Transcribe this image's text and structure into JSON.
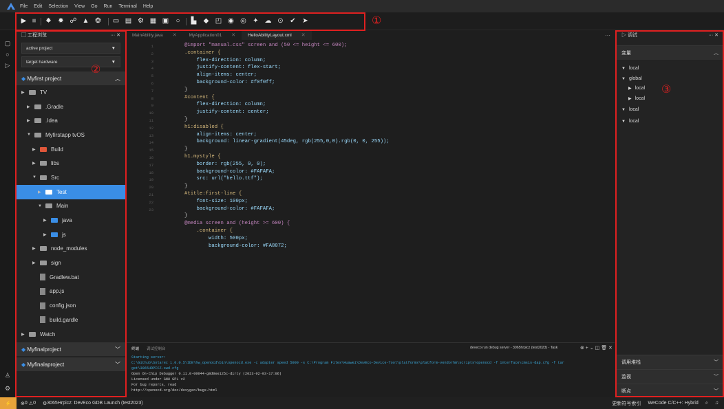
{
  "menu": [
    "File",
    "Edit",
    "Selection",
    "View",
    "Go",
    "Run",
    "Terminal",
    "Help"
  ],
  "toolbar": {
    "icons": [
      "run-icon",
      "stop-icon",
      "build-icon",
      "clean-icon",
      "debug-icon",
      "warning-icon",
      "settings-icon",
      "device-icon",
      "save-icon",
      "gear-icon",
      "grid-icon",
      "chip-icon",
      "search-icon",
      "file-icon",
      "preview-icon",
      "layout-icon",
      "deploy-icon",
      "record-icon",
      "plugin-icon",
      "cloud-icon",
      "target-icon",
      "check-icon",
      "send-icon"
    ]
  },
  "callouts": {
    "one": "①",
    "two": "②",
    "three": "③"
  },
  "explorer": {
    "title": "工程浏览",
    "dropdown1": "active project",
    "dropdown2": "target hardware",
    "project1": "Myfirst project",
    "tree": [
      {
        "label": "TV",
        "type": "folder",
        "arrow": "▶"
      },
      {
        "label": ".Gradle",
        "type": "folder",
        "arrow": "▶"
      },
      {
        "label": ".Idea",
        "type": "folder",
        "arrow": "▶"
      },
      {
        "label": "Myfirstapp tvOS",
        "type": "folder",
        "arrow": "▼"
      },
      {
        "label": "Build",
        "type": "folder",
        "arrow": "▶"
      },
      {
        "label": "libs",
        "type": "folder",
        "arrow": "▶"
      },
      {
        "label": "Src",
        "type": "folder",
        "arrow": "▼"
      },
      {
        "label": "Test",
        "type": "folder",
        "arrow": "▶"
      },
      {
        "label": "Main",
        "type": "folder",
        "arrow": "▼"
      },
      {
        "label": "java",
        "type": "folder",
        "arrow": "▶"
      },
      {
        "label": "js",
        "type": "folder",
        "arrow": "▶"
      },
      {
        "label": "node_modules",
        "type": "folder",
        "arrow": "▶"
      },
      {
        "label": "sign",
        "type": "folder",
        "arrow": "▶"
      },
      {
        "label": "Gradlew.bat",
        "type": "file",
        "arrow": ""
      },
      {
        "label": "app.js",
        "type": "file",
        "arrow": ""
      },
      {
        "label": "config.json",
        "type": "file",
        "arrow": ""
      },
      {
        "label": "build.gardle",
        "type": "file",
        "arrow": ""
      },
      {
        "label": "Watch",
        "type": "folder",
        "arrow": "▶"
      }
    ],
    "project2": "Myfinalproject",
    "project3": "Myfinalaproject"
  },
  "tabs": [
    {
      "label": "MainAbility.java",
      "active": false
    },
    {
      "label": "MyApplication01",
      "active": false
    },
    {
      "label": "HelloAbilityLayout.xml",
      "active": true
    }
  ],
  "editor": {
    "lines": [
      {
        "n": "1",
        "t": "@import \"manual.css\" screen and (50 <= height <= 600);",
        "c": "c-at"
      },
      {
        "n": "2",
        "t": ".container {",
        "c": "c-sel"
      },
      {
        "n": "3",
        "t": "    flex-direction: column;",
        "c": "c-prop"
      },
      {
        "n": "4",
        "t": "    justify-content: flex-start;",
        "c": "c-prop"
      },
      {
        "n": "5",
        "t": "    align-items: center;",
        "c": "c-prop"
      },
      {
        "n": "6",
        "t": "    background-color: #f0f0ff;",
        "c": "c-prop"
      },
      {
        "n": "7",
        "t": "}",
        "c": ""
      },
      {
        "n": "8",
        "t": "#content {",
        "c": "c-sel"
      },
      {
        "n": "9",
        "t": "    flex-direction: column;",
        "c": "c-prop"
      },
      {
        "n": "10",
        "t": "    justify-content: center;",
        "c": "c-prop"
      },
      {
        "n": "11",
        "t": "}",
        "c": ""
      },
      {
        "n": "12",
        "t": "h1:disabled {",
        "c": "c-sel"
      },
      {
        "n": "13",
        "t": "    align-items: center;",
        "c": "c-prop"
      },
      {
        "n": "14",
        "t": "    background: linear-gradient(45deg, rgb(255,0,0).rgb(0, 0, 255));",
        "c": "c-prop"
      },
      {
        "n": "15",
        "t": "}",
        "c": ""
      },
      {
        "n": "16",
        "t": "h1.mystyle {",
        "c": "c-sel"
      },
      {
        "n": "17",
        "t": "    border: rgb(255, 0, 0);",
        "c": "c-prop"
      },
      {
        "n": "18",
        "t": "    background-color: #FAFAFA;",
        "c": "c-prop"
      },
      {
        "n": "19",
        "t": "    src: url(\"hello.ttf\");",
        "c": "c-prop"
      },
      {
        "n": "20",
        "t": "}",
        "c": ""
      },
      {
        "n": "21",
        "t": "#title:first-line {",
        "c": "c-sel"
      },
      {
        "n": "22",
        "t": "    font-size: 100px;",
        "c": "c-prop"
      },
      {
        "n": "23",
        "t": "    background-color: #FAFAFA;",
        "c": "c-prop"
      },
      {
        "n": "",
        "t": "}",
        "c": ""
      },
      {
        "n": "",
        "t": "@media screen and (height >= 600) {",
        "c": "c-at"
      },
      {
        "n": "",
        "t": "    .container {",
        "c": "c-sel"
      },
      {
        "n": "",
        "t": "        width: 500px;",
        "c": "c-prop"
      },
      {
        "n": "",
        "t": "        background-color: #FA8072;",
        "c": "c-prop"
      }
    ]
  },
  "terminal": {
    "tab1": "终端",
    "tab2": "调试控制台",
    "task": "deveco run debug server - 3065hrpicz (test2023) - Task",
    "lines": [
      "Starting server:",
      "C:\\Github\\Solarec 1.0.0.5\\IDE\\hw_openocd\\bin\\openocd.exe -c adapter speed 5000 -s C:\\Program Files\\Huawei\\DevEco-Device-Tool\\platforms\\platform-vendorhm\\scripts\\openocd -f interface\\cmsis-dap.cfg -f tar",
      "get\\3065HRPICZ-swd.cfg",
      "Open On-Chip Debugger 0.11.0-00044-g8d0ee125c-dirty (2023-02-03-17:06)",
      "Licensed under GNU GPL v2",
      "For bug reports, read",
      "        http://openocd.org/doc/doxygen/bugs.html"
    ]
  },
  "debug": {
    "title": "调试",
    "variables": "变量",
    "vars": [
      {
        "label": "local",
        "arrow": "▼",
        "indent": 0
      },
      {
        "label": "global",
        "arrow": "▼",
        "indent": 0
      },
      {
        "label": "local",
        "arrow": "▶",
        "indent": 1
      },
      {
        "label": "local",
        "arrow": "▶",
        "indent": 1
      },
      {
        "label": "local",
        "arrow": "▼",
        "indent": 0
      },
      {
        "label": "local",
        "arrow": "▼",
        "indent": 0
      }
    ],
    "callstack": "调用堆栈",
    "watch": "监视",
    "breakpoints": "断点"
  },
  "status": {
    "errors": "0",
    "warnings": "0",
    "launch": "3065Hrpicz: DevEco GDB Launch (test2023)",
    "index": "更新符号索引",
    "lang": "WeCode C/C++: Hybrid"
  }
}
